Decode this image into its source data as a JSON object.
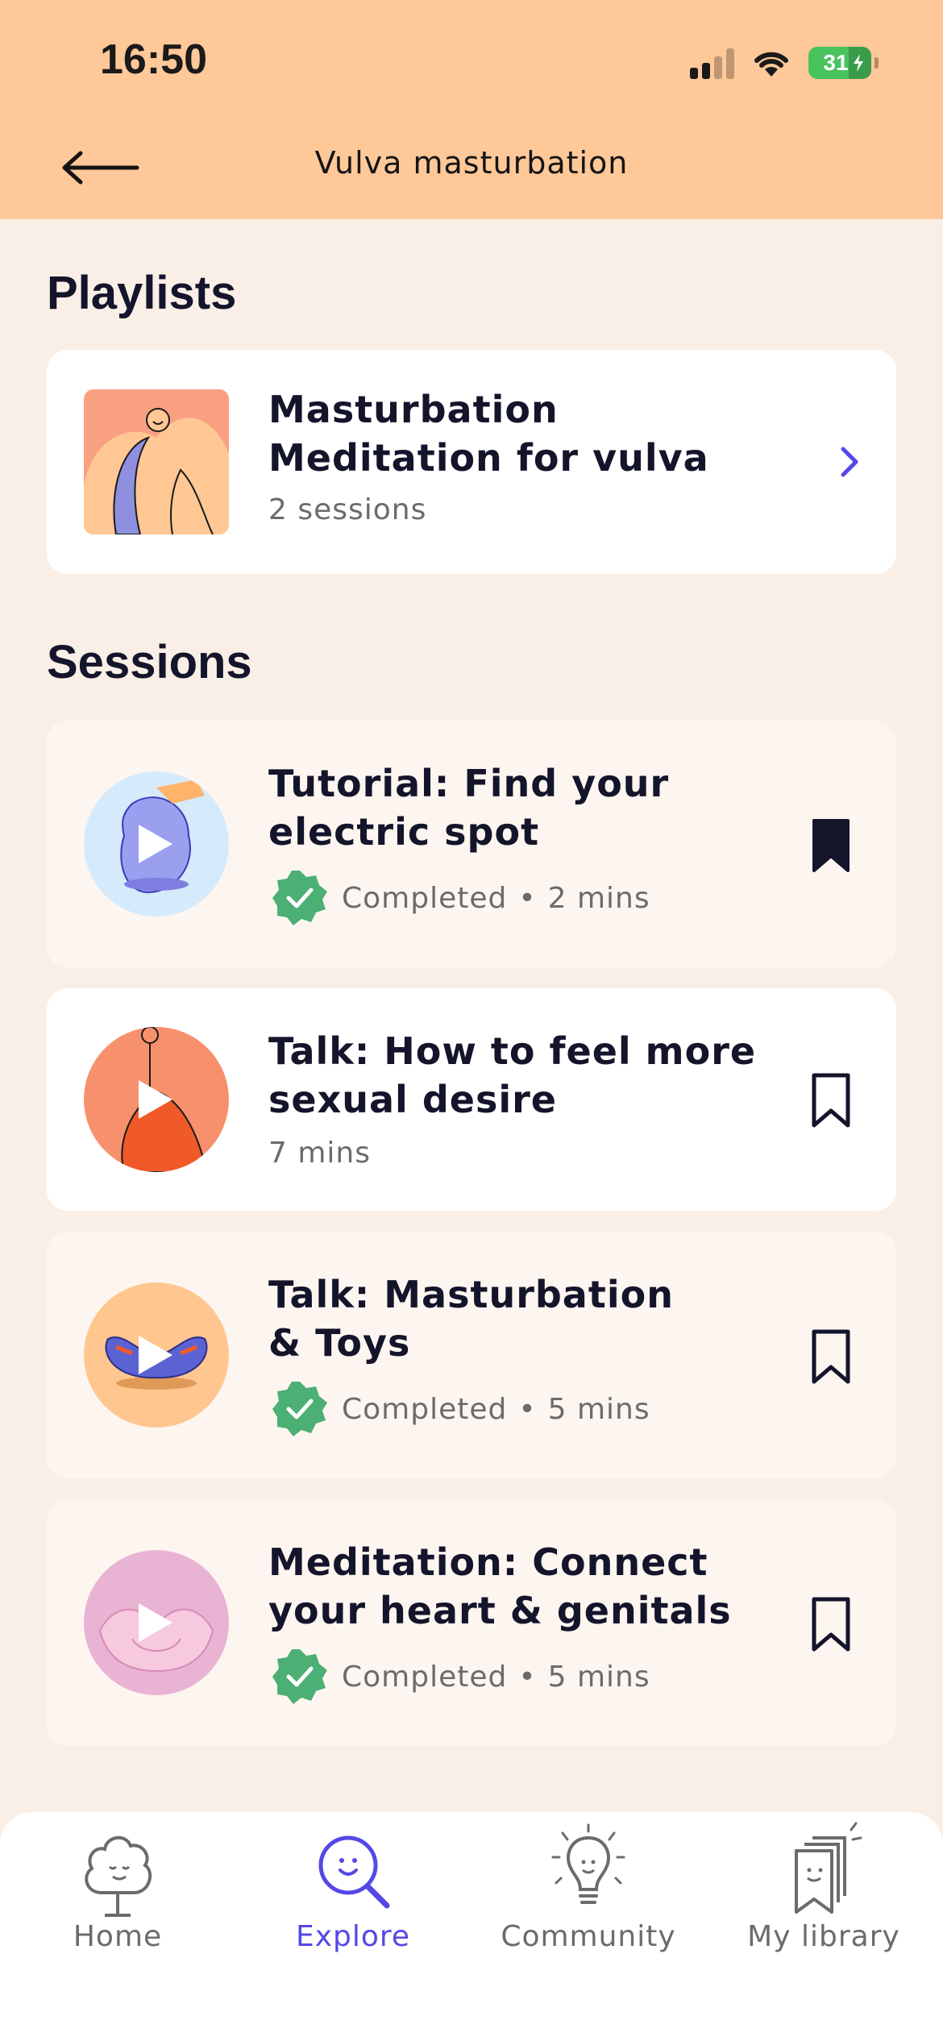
{
  "status_bar": {
    "time": "16:50",
    "battery": "31"
  },
  "header": {
    "title": "Vulva masturbation",
    "back_icon": "arrow-left-icon"
  },
  "playlists": {
    "heading": "Playlists",
    "items": [
      {
        "title_line1": "Masturbation",
        "title_line2": "Meditation for vulva",
        "meta": "2 sessions"
      }
    ]
  },
  "sessions": {
    "heading": "Sessions",
    "items": [
      {
        "title_line1": "Tutorial: Find your",
        "title_line2": "electric spot",
        "status": "Completed",
        "duration": "2 mins",
        "bookmarked": true
      },
      {
        "title_line1": "Talk: How to feel more",
        "title_line2": "sexual desire",
        "status": "",
        "duration": "7 mins",
        "bookmarked": false
      },
      {
        "title_line1": "Talk: Masturbation",
        "title_line2": "& Toys",
        "status": "Completed",
        "duration": "5 mins",
        "bookmarked": false
      },
      {
        "title_line1": "Meditation: Connect",
        "title_line2": "your heart & genitals",
        "status": "Completed",
        "duration": "5 mins",
        "bookmarked": false
      }
    ]
  },
  "separator": "•",
  "bottom_nav": [
    {
      "label": "Home",
      "icon": "tree-face-icon",
      "active": false
    },
    {
      "label": "Explore",
      "icon": "magnifier-face-icon",
      "active": true
    },
    {
      "label": "Community",
      "icon": "lightbulb-icon",
      "active": false
    },
    {
      "label": "My library",
      "icon": "bookmark-stack-icon",
      "active": false
    }
  ],
  "colors": {
    "header_bg": "#ffc898",
    "page_bg": "#f9efe7",
    "accent": "#5448e6",
    "completed_green": "#4caf73"
  }
}
